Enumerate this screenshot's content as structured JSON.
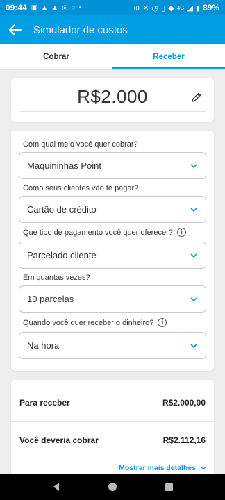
{
  "status_bar": {
    "time": "09:44",
    "network": "4G",
    "battery": "89%"
  },
  "app_bar": {
    "title": "Simulador de custos"
  },
  "tabs": [
    {
      "label": "Cobrar",
      "active": false
    },
    {
      "label": "Receber",
      "active": true
    }
  ],
  "amount": {
    "value": "R$2.000"
  },
  "form": {
    "q1": {
      "label": "Com qual meio você quer cobrar?",
      "value": "Maquininhas Point"
    },
    "q2": {
      "label": "Como seus clientes vão te pagar?",
      "value": "Cartão de crédito"
    },
    "q3": {
      "label": "Que tipo de pagamento você quer oferecer?",
      "value": "Parcelado cliente"
    },
    "q4": {
      "label": "Em quantas vezes?",
      "value": "10 parcelas"
    },
    "q5": {
      "label": "Quando você quer receber o dinheiro?",
      "value": "Na hora"
    }
  },
  "summary": {
    "receive_label": "Para receber",
    "receive_value": "R$2.000,00",
    "charge_label": "Você deveria cobrar",
    "charge_value": "R$2.112,16",
    "more_details": "Mostrar mais detalhes"
  },
  "colors": {
    "status_bar": "#0091d6",
    "app_bar": "#009ee3",
    "accent": "#009ee3",
    "background": "#eeeeee"
  }
}
